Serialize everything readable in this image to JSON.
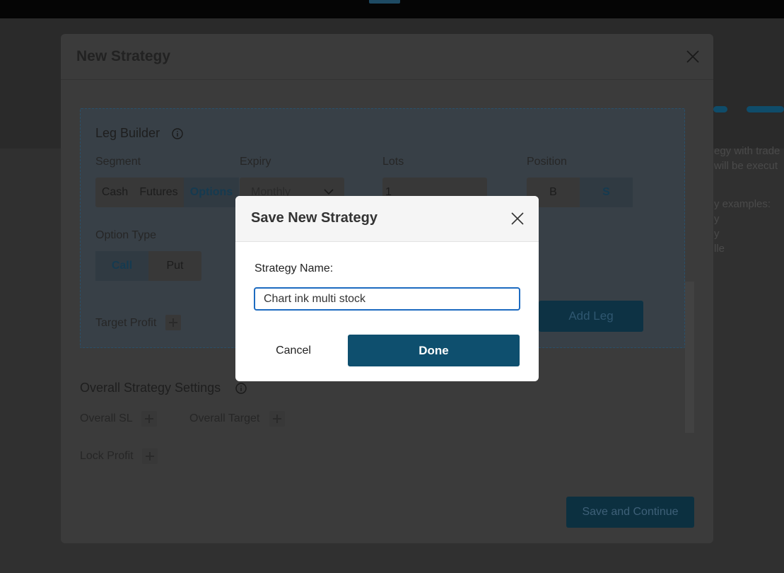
{
  "background": {
    "side_text": [
      "egy with trade",
      "will be execut",
      "y examples:",
      "y",
      "y",
      "lle"
    ]
  },
  "main_modal": {
    "title": "New Strategy",
    "leg_builder": {
      "title": "Leg Builder",
      "segment_label": "Segment",
      "segment_options": [
        "Cash",
        "Futures",
        "Options"
      ],
      "segment_selected": "Options",
      "expiry_label": "Expiry",
      "expiry_value": "Monthly",
      "lots_label": "Lots",
      "lots_value": "1",
      "position_label": "Position",
      "position_options": [
        "B",
        "S"
      ],
      "position_selected": "S",
      "option_type_label": "Option Type",
      "option_type_options": [
        "Call",
        "Put"
      ],
      "option_type_selected": "Call",
      "target_profit_label": "Target Profit",
      "add_leg_label": "Add Leg"
    },
    "overall": {
      "title": "Overall Strategy Settings",
      "overall_sl_label": "Overall SL",
      "overall_target_label": "Overall Target",
      "lock_profit_label": "Lock Profit"
    },
    "save_continue_label": "Save and Continue"
  },
  "dialog": {
    "title": "Save New Strategy",
    "field_label": "Strategy Name:",
    "field_value": "Chart ink multi stock",
    "cancel_label": "Cancel",
    "done_label": "Done"
  },
  "colors": {
    "primary": "#0e4f6e",
    "input_focus": "#1d6bc0",
    "overlay": "#1a1a1a"
  }
}
